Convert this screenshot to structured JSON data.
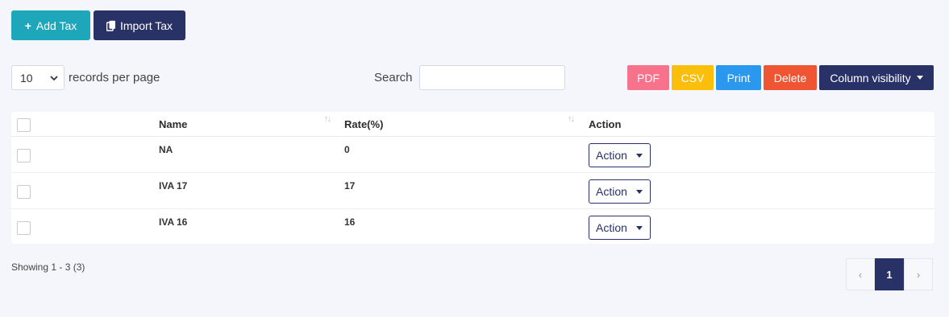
{
  "toolbar": {
    "add_label": "Add Tax",
    "import_label": "Import Tax"
  },
  "controls": {
    "page_length": "10",
    "page_length_label": "records per page",
    "search_label": "Search",
    "search_value": "",
    "export": {
      "pdf": "PDF",
      "csv": "CSV",
      "print": "Print",
      "delete": "Delete",
      "column_visibility": "Column visibility"
    },
    "colors": {
      "add": "#1ea7bb",
      "primary": "#283267",
      "pdf": "#f7738c",
      "csv": "#fbbe0b",
      "print": "#2b98f0",
      "delete": "#ef5533"
    }
  },
  "table": {
    "columns": [
      "Name",
      "Rate(%)",
      "Action"
    ],
    "rows": [
      {
        "name": "NA",
        "rate": "0",
        "action": "Action"
      },
      {
        "name": "IVA 17",
        "rate": "17",
        "action": "Action"
      },
      {
        "name": "IVA 16",
        "rate": "16",
        "action": "Action"
      }
    ]
  },
  "footer": {
    "info": "Showing 1 - 3 (3)",
    "prev": "‹",
    "current_page": "1",
    "next": "›"
  }
}
